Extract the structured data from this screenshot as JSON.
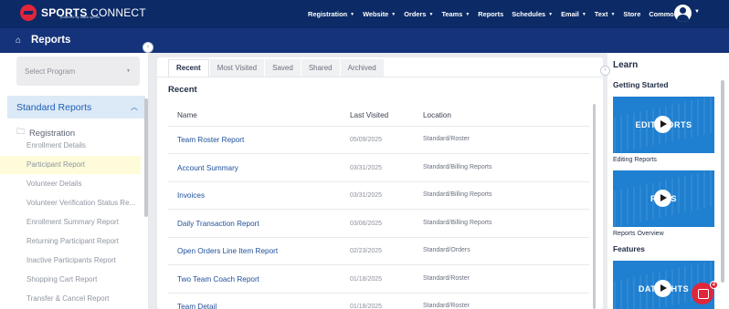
{
  "brand": {
    "name_bold": "SPORTS",
    "name_light": "CONNECT",
    "sub": "powered by stack sports"
  },
  "nav": [
    {
      "label": "Registration",
      "caret": true
    },
    {
      "label": "Website",
      "caret": true
    },
    {
      "label": "Orders",
      "caret": true
    },
    {
      "label": "Teams",
      "caret": true
    },
    {
      "label": "Reports",
      "caret": false
    },
    {
      "label": "Schedules",
      "caret": true
    },
    {
      "label": "Email",
      "caret": true
    },
    {
      "label": "Text",
      "caret": true
    },
    {
      "label": "Store",
      "caret": false
    },
    {
      "label": "Common",
      "caret": true
    }
  ],
  "page": {
    "title": "Reports",
    "home_icon": "home-icon"
  },
  "sidebar": {
    "select_placeholder": "Select Program",
    "section_label": "Standard Reports",
    "folder_label": "Registration",
    "items": [
      {
        "label": "Enrollment Details",
        "active": false
      },
      {
        "label": "Participant Report",
        "active": true
      },
      {
        "label": "Volunteer Details",
        "active": false
      },
      {
        "label": "Volunteer Verification Status Re...",
        "active": false
      },
      {
        "label": "Enrollment Summary Report",
        "active": false
      },
      {
        "label": "Returning Participant Report",
        "active": false
      },
      {
        "label": "Inactive Participants Report",
        "active": false
      },
      {
        "label": "Shopping Cart Report",
        "active": false
      },
      {
        "label": "Transfer & Cancel Report",
        "active": false
      }
    ]
  },
  "tabs": [
    {
      "label": "Recent",
      "active": true
    },
    {
      "label": "Most Visited",
      "active": false
    },
    {
      "label": "Saved",
      "active": false
    },
    {
      "label": "Shared",
      "active": false
    },
    {
      "label": "Archived",
      "active": false
    }
  ],
  "main": {
    "section_title": "Recent",
    "columns": {
      "name": "Name",
      "last_visited": "Last Visited",
      "location": "Location"
    },
    "rows": [
      {
        "name": "Team Roster Report",
        "date": "05/09/2025",
        "location": "Standard/Roster"
      },
      {
        "name": "Account Summary",
        "date": "03/31/2025",
        "location": "Standard/Billing Reports"
      },
      {
        "name": "Invoices",
        "date": "03/31/2025",
        "location": "Standard/Billing Reports"
      },
      {
        "name": "Daily Transaction Report",
        "date": "03/06/2025",
        "location": "Standard/Billing Reports"
      },
      {
        "name": "Open Orders Line Item Report",
        "date": "02/23/2025",
        "location": "Standard/Orders"
      },
      {
        "name": "Two Team Coach Report",
        "date": "01/18/2025",
        "location": "Standard/Roster"
      },
      {
        "name": "Team Detail",
        "date": "01/18/2025",
        "location": "Standard/Roster"
      }
    ]
  },
  "learn": {
    "title": "Learn",
    "getting_started": "Getting Started",
    "features": "Features",
    "videos": [
      {
        "thumb_text": "EDITI   PORTS",
        "caption": "Editing Reports"
      },
      {
        "thumb_text": "RE      TS",
        "caption": "Reports Overview"
      },
      {
        "thumb_text": "DATA    GHTS",
        "caption": ""
      }
    ]
  },
  "chat": {
    "badge": "2"
  },
  "colors": {
    "topbar": "#0b2a66",
    "subheader": "#15337a",
    "accent": "#e0263b",
    "link": "#1e4f9a",
    "section_bg": "#dce9f7"
  }
}
